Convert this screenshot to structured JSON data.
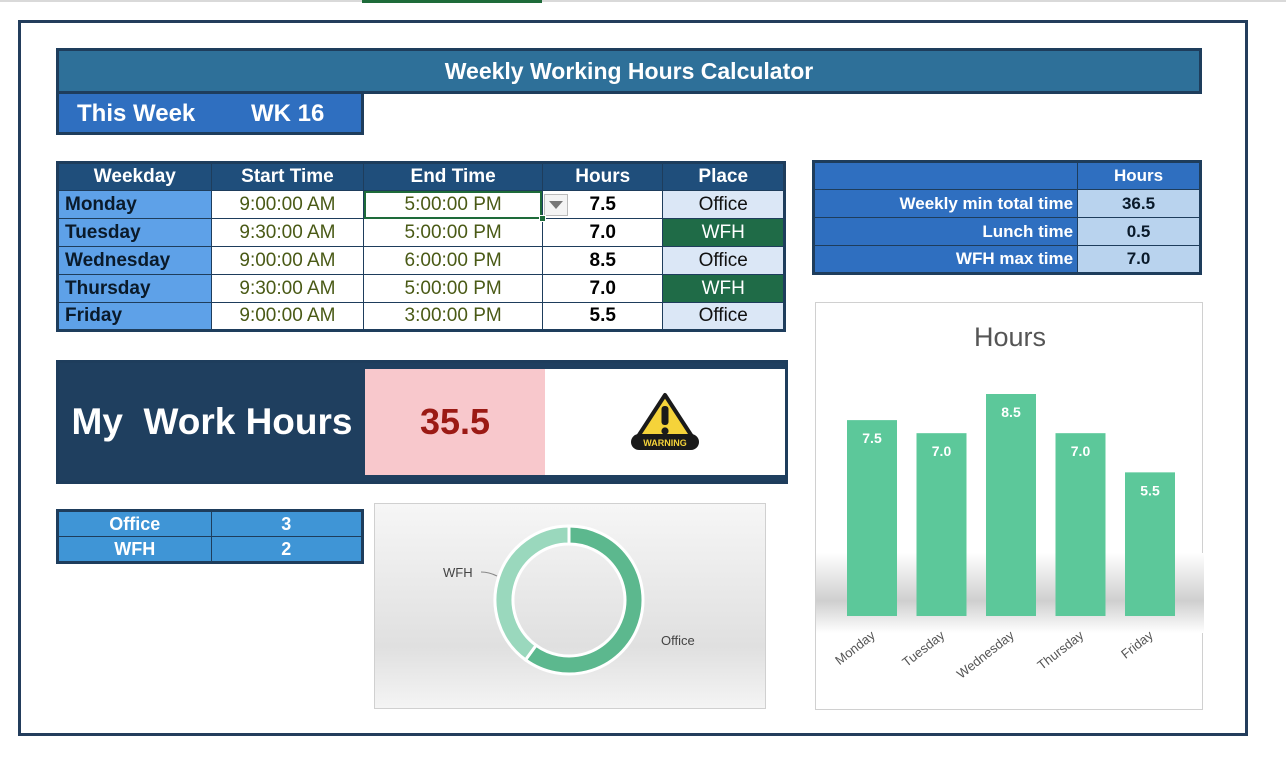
{
  "title": "Weekly Working Hours Calculator",
  "week": {
    "label": "This Week",
    "value": "WK 16"
  },
  "schedule": {
    "headers": [
      "Weekday",
      "Start Time",
      "End Time",
      "Hours",
      "Place"
    ],
    "rows": [
      {
        "day": "Monday",
        "start": "9:00:00 AM",
        "end": "5:00:00 PM",
        "hours": "7.5",
        "place": "Office"
      },
      {
        "day": "Tuesday",
        "start": "9:30:00 AM",
        "end": "5:00:00 PM",
        "hours": "7.0",
        "place": "WFH"
      },
      {
        "day": "Wednesday",
        "start": "9:00:00 AM",
        "end": "6:00:00 PM",
        "hours": "8.5",
        "place": "Office"
      },
      {
        "day": "Thursday",
        "start": "9:30:00 AM",
        "end": "5:00:00 PM",
        "hours": "7.0",
        "place": "WFH"
      },
      {
        "day": "Friday",
        "start": "9:00:00 AM",
        "end": "3:00:00 PM",
        "hours": "5.5",
        "place": "Office"
      }
    ]
  },
  "settings": {
    "header": "Hours",
    "rows": [
      {
        "label": "Weekly min total time",
        "value": "36.5"
      },
      {
        "label": "Lunch time",
        "value": "0.5"
      },
      {
        "label": "WFH max time",
        "value": "7.0"
      }
    ]
  },
  "work_hours": {
    "label": "My  Work Hours",
    "value": "35.5",
    "icon": "warning-icon",
    "icon_text": "WARNING"
  },
  "place_counts": [
    {
      "label": "Office",
      "value": "3"
    },
    {
      "label": "WFH",
      "value": "2"
    }
  ],
  "colors": {
    "accent": "#2e7099",
    "dark": "#1f3f5f",
    "bar": "#5cc89a",
    "wfh": "#1f6b47",
    "alert_bg": "#f8c8cc",
    "alert_text": "#9b1a14"
  },
  "chart_data": [
    {
      "type": "pie",
      "variant": "donut",
      "categories": [
        "Office",
        "WFH"
      ],
      "values": [
        3,
        2
      ],
      "colors": [
        "#5cb88e",
        "#9ad8bd"
      ]
    },
    {
      "type": "bar",
      "title": "Hours",
      "categories": [
        "Monday",
        "Tuesday",
        "Wednesday",
        "Thursday",
        "Friday"
      ],
      "values": [
        7.5,
        7.0,
        8.5,
        7.0,
        5.5
      ],
      "data_labels": [
        "7.5",
        "7.0",
        "8.5",
        "7.0",
        "5.5"
      ],
      "ylim": [
        0,
        8.5
      ],
      "grid": false,
      "legend": "none"
    }
  ]
}
